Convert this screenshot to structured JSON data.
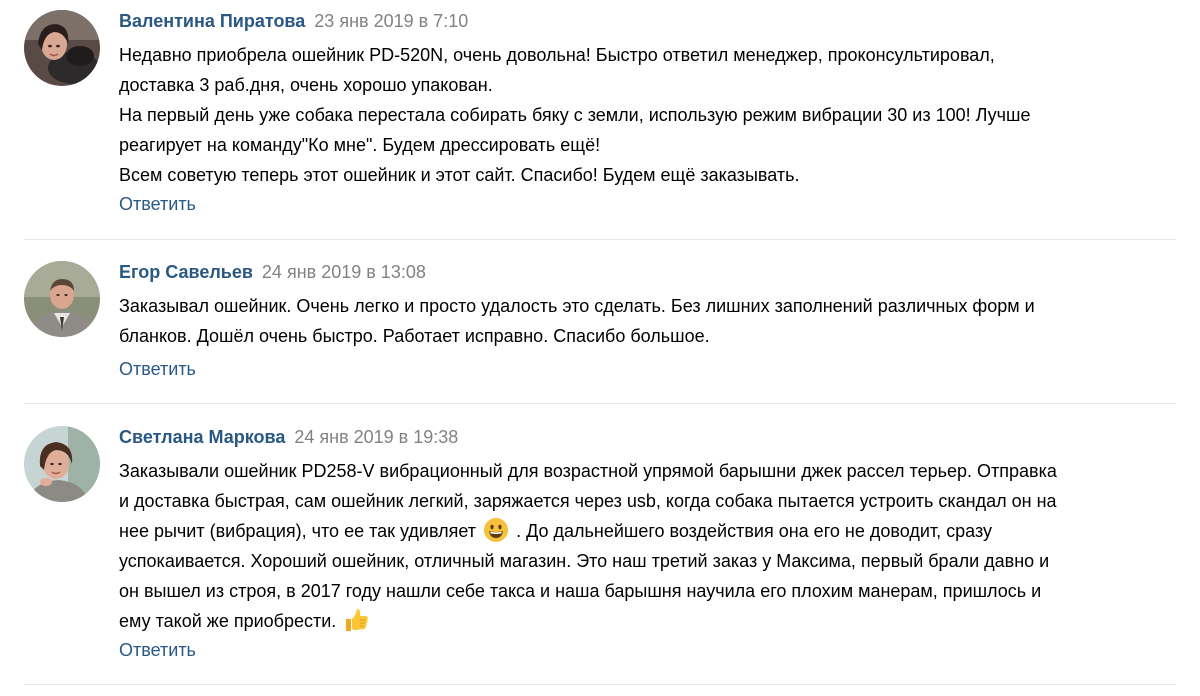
{
  "comments": [
    {
      "author": "Валентина Пиратова",
      "date": "23 янв 2019 в 7:10",
      "lines": [
        "Недавно приобрела ошейник PD-520N, очень довольна! Быстро ответил менеджер, проконсультировал,",
        "доставка 3 раб.дня, очень хорошо упакован.",
        "На первый день уже собака перестала собирать бяку с земли, использую режим вибрации 30 из 100! Лучше",
        "реагирует на команду\"Ко мне\". Будем дрессировать ещё!",
        "Всем советую теперь этот ошейник и этот сайт. Спасибо! Будем ещё заказывать."
      ],
      "reply_label": "Ответить"
    },
    {
      "author": "Егор Савельев",
      "date": "24 янв 2019 в 13:08",
      "lines": [
        "Заказывал ошейник. Очень легко и просто удалость это сделать. Без лишних заполнений различных форм и",
        "бланков. Дошёл очень быстро. Работает исправно. Спасибо большое."
      ],
      "reply_label": "Ответить"
    },
    {
      "author": "Светлана Маркова",
      "date": "24 янв 2019 в 19:38",
      "lines": [
        "Заказывали ошейник PD258-V вибрационный для возрастной упрямой барышни джек рассел терьер. Отправка",
        "и доставка быстрая, сам ошейник легкий, заряжается через usb, когда собака пытается устроить скандал он на",
        "нее рычит (вибрация), что ее так удивляет",
        ". До дальнейшего воздействия она его не доводит, сразу",
        "успокаивается. Хороший ошейник, отличный магазин. Это наш третий заказ у Максима, первый брали давно и",
        "он вышел из строя, в 2017 году нашли себе такса и наша барышня научила его плохим манерам, пришлось и",
        "ему такой же приобрести."
      ],
      "reply_label": "Ответить",
      "emojis": [
        "grinning-face-emoji",
        "thumbs-up-emoji"
      ]
    }
  ],
  "colors": {
    "author": "#2a5885",
    "date": "#828282",
    "reply": "#2a5885",
    "divider": "#e7e8ec"
  }
}
